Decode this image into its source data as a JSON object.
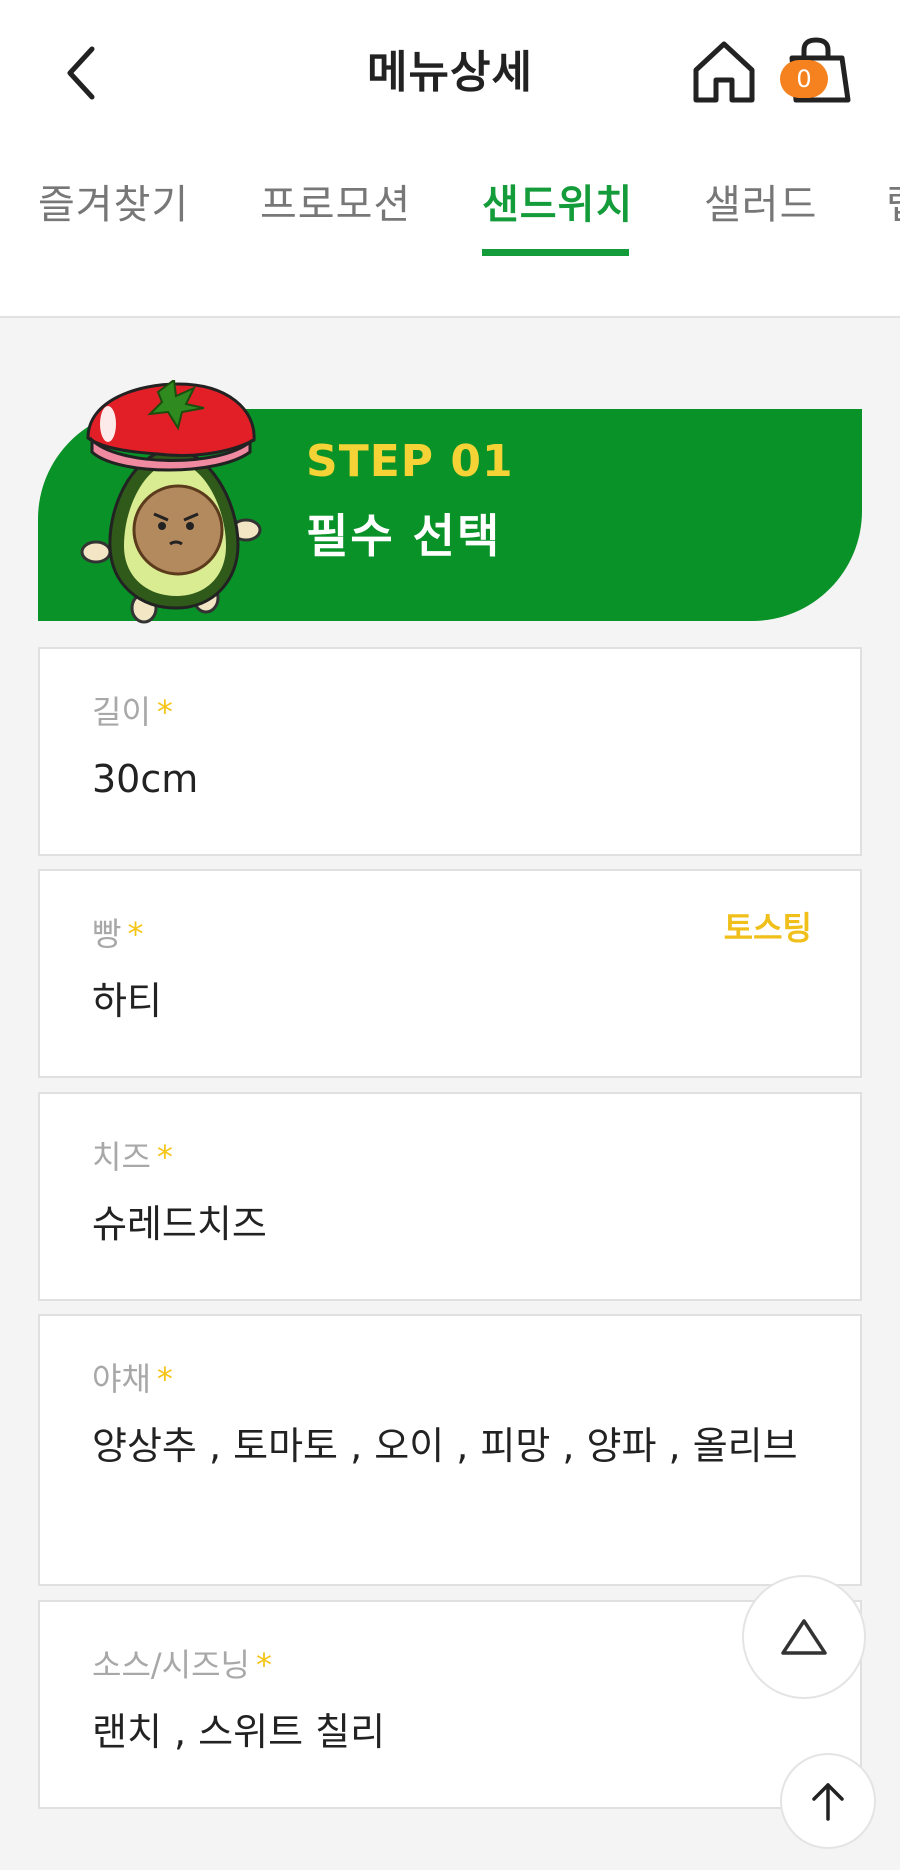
{
  "header": {
    "title": "메뉴상세",
    "back_icon": "chevron-left-icon",
    "home_icon": "home-icon",
    "cart_icon": "shopping-bag-icon",
    "cart_count": "0"
  },
  "tabs": [
    {
      "label": "즐겨찾기",
      "active": false
    },
    {
      "label": "프로모션",
      "active": false
    },
    {
      "label": "샌드위치",
      "active": true
    },
    {
      "label": "샐러드",
      "active": false
    },
    {
      "label": "랩",
      "active": false
    }
  ],
  "step": {
    "label": "STEP 01",
    "subtitle": "필수 선택"
  },
  "options": [
    {
      "label": "길이",
      "required_mark": "*",
      "value": "30cm"
    },
    {
      "label": "빵",
      "required_mark": "*",
      "value": "하티",
      "extra": "토스팅"
    },
    {
      "label": "치즈",
      "required_mark": "*",
      "value": "슈레드치즈"
    },
    {
      "label": "야채",
      "required_mark": "*",
      "value": "양상추 , 토마토 , 오이 , 피망 , 양파 , 올리브"
    },
    {
      "label": "소스/시즈닝",
      "required_mark": "*",
      "value": "랜치 , 스위트 칠리"
    }
  ],
  "colors": {
    "brand_green": "#089227",
    "step_yellow": "#f5d235",
    "badge_orange": "#f5821f",
    "required_yellow": "#f5c518"
  }
}
